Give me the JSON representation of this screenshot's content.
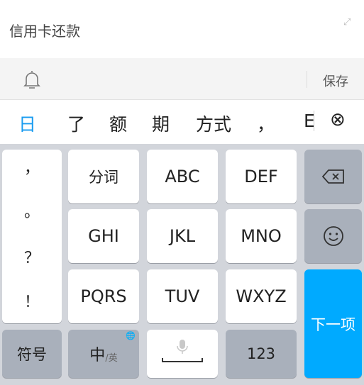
{
  "header": {
    "title": "信用卡还款",
    "expand_icon": "expand-icon"
  },
  "toolbar": {
    "bell_icon": "bell-icon",
    "save_label": "保存"
  },
  "candidates": {
    "items": [
      "日",
      "了",
      "额",
      "期",
      "方式",
      "，",
      "E"
    ],
    "active_color": "#1a9cf0",
    "close_icon": "circle-x-icon"
  },
  "keyboard": {
    "punct": [
      "，",
      "。",
      "？",
      "！"
    ],
    "rows": [
      [
        "分词",
        "ABC",
        "DEF"
      ],
      [
        "GHI",
        "JKL",
        "MNO"
      ],
      [
        "PQRS",
        "TUV",
        "WXYZ"
      ]
    ],
    "backspace_icon": "backspace-icon",
    "emoji_icon": "smiley-icon",
    "next_label": "下一项",
    "symbols_label": "符号",
    "lang_main": "中",
    "lang_alt": "/英",
    "globe_icon": "globe-icon",
    "mic_icon": "mic-icon",
    "num_label": "123",
    "accent": "#00aaff"
  }
}
